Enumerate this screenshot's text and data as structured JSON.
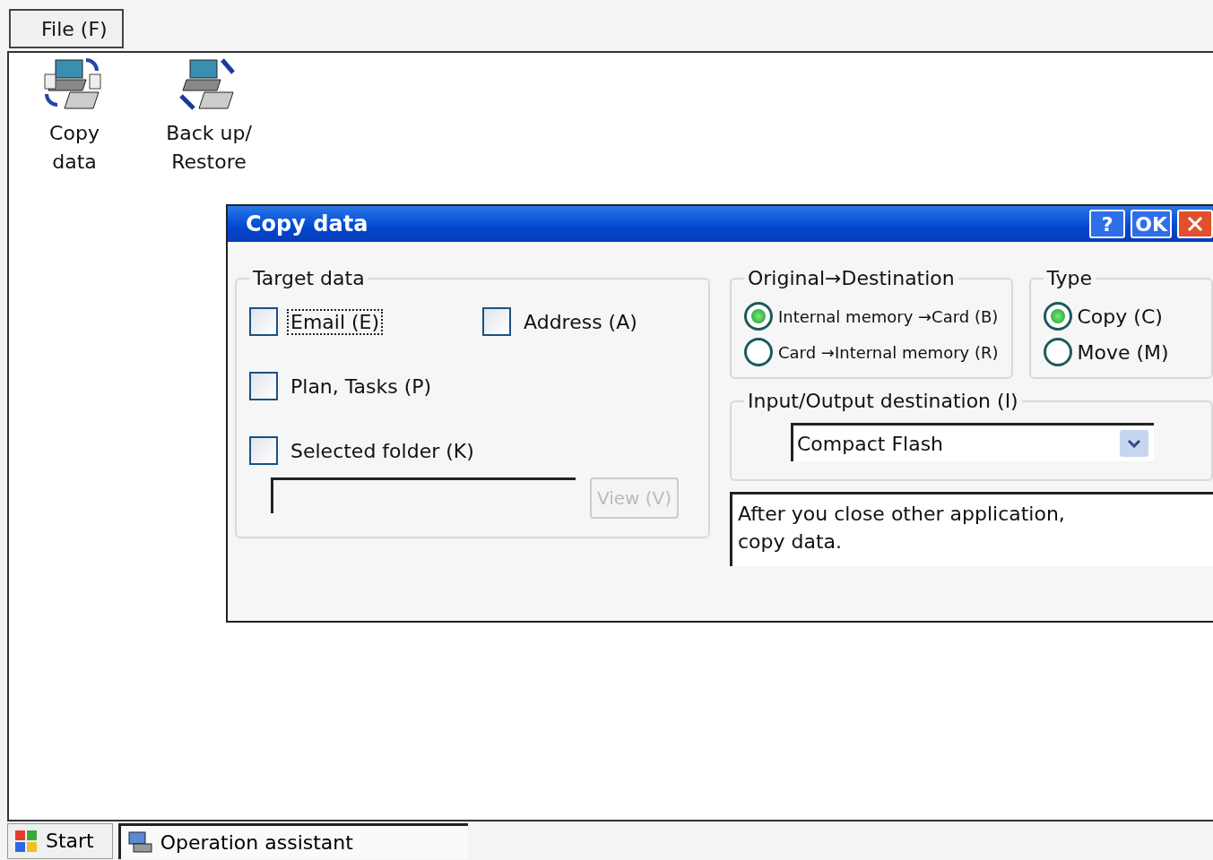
{
  "menu": [
    {
      "label": "File (F)"
    }
  ],
  "desktop_icons": [
    {
      "kind": "copy",
      "label": "Copy data"
    },
    {
      "kind": "backup",
      "label": "Back up/ Restore"
    }
  ],
  "dialog": {
    "title": "Copy data",
    "help_button": "?",
    "ok_button": "OK",
    "target_data": {
      "legend": "Target data",
      "options": [
        {
          "label": "Email (E)",
          "checked": false,
          "focused": true
        },
        {
          "label": "Address (A)",
          "checked": false,
          "focused": false
        },
        {
          "label": "Plan, Tasks (P)",
          "checked": false,
          "focused": false
        },
        {
          "label": "Selected folder (K)",
          "checked": false,
          "focused": false
        }
      ],
      "view_button": {
        "label": "View (V)",
        "disabled": true
      }
    },
    "direction": {
      "legend": "Original→Destination",
      "options": [
        {
          "label": "Internal memory →Card (B)",
          "selected": true
        },
        {
          "label": "Card →Internal memory (R)",
          "selected": false
        }
      ]
    },
    "type": {
      "legend": "Type",
      "options": [
        {
          "label": "Copy (C)",
          "selected": true
        },
        {
          "label": "Move (M)",
          "selected": false
        }
      ]
    },
    "io_destination": {
      "legend": "Input/Output destination (I)",
      "value": "Compact Flash"
    },
    "message_lines": [
      "After you close other application,",
      "copy data."
    ]
  },
  "taskbar": {
    "start": "Start",
    "tasks": [
      {
        "label": "Operation assistant"
      }
    ]
  }
}
